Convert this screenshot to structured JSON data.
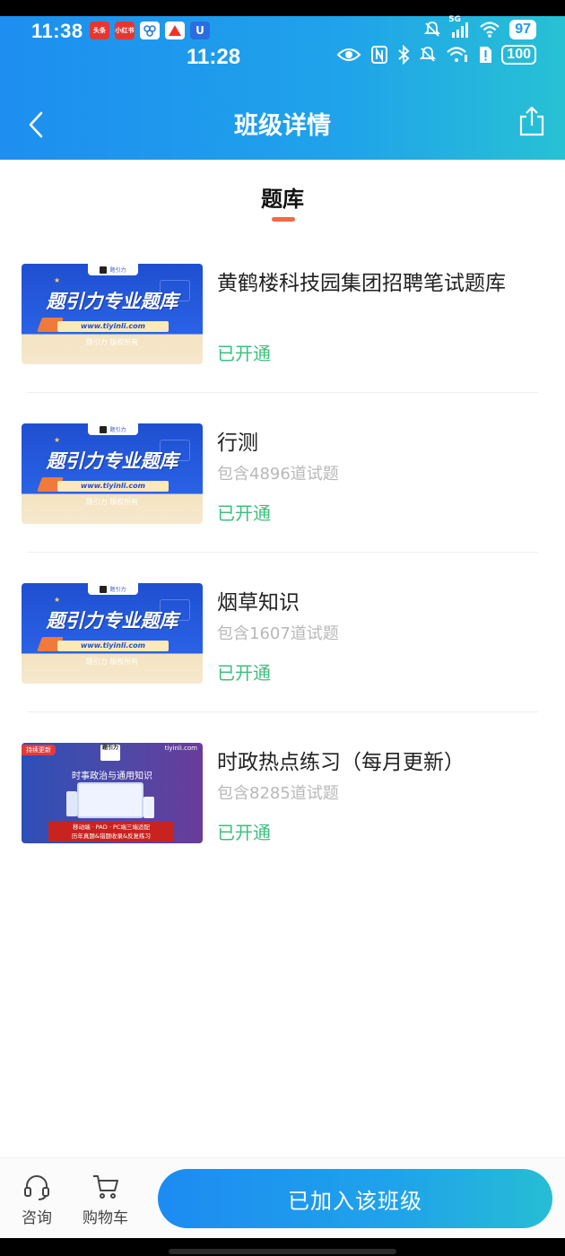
{
  "status_bar": {
    "time_left": "11:38",
    "time_center": "11:28",
    "apps": [
      {
        "label": "头条",
        "color": "#e8362f"
      },
      {
        "label": "小红书",
        "color": "#e8362f"
      },
      {
        "label": "",
        "color": "#2a7de1"
      },
      {
        "label": "",
        "color": "#e8362f"
      },
      {
        "label": "U",
        "color": "#2a6de1"
      }
    ],
    "network": "5G",
    "battery_top": "97",
    "battery_bottom": "100"
  },
  "nav": {
    "title": "班级详情"
  },
  "tabs": [
    {
      "label": "题库",
      "active": true
    }
  ],
  "thumb_text": {
    "brand": "题引力专业题库",
    "logo_label": "题引力",
    "url": "www.tiyinli.com",
    "copyright": "题引力 版权所有",
    "b_badge": "持续更新",
    "b_site": "tiyinli.com",
    "b_mark": "题引力",
    "b_head": "时事政治与通用知识",
    "b_red_line1": "移动端 · PAD · PC端三端适配",
    "b_red_line2": "历年真题&错题收录&反复练习"
  },
  "items": [
    {
      "title": "黄鹤楼科技园集团招聘笔试题库",
      "count": "",
      "status": "已开通",
      "thumb": "A"
    },
    {
      "title": "行测",
      "count": "包含4896道试题",
      "status": "已开通",
      "thumb": "A"
    },
    {
      "title": "烟草知识",
      "count": "包含1607道试题",
      "status": "已开通",
      "thumb": "A"
    },
    {
      "title": "时政热点练习（每月更新）",
      "count": "包含8285道试题",
      "status": "已开通",
      "thumb": "B"
    }
  ],
  "bottom": {
    "consult_label": "咨询",
    "cart_label": "购物车",
    "join_label": "已加入该班级"
  },
  "colors": {
    "header_start": "#1e8ef0",
    "header_end": "#27c1d4",
    "status_green": "#3cbf7c",
    "tab_underline": "#ef6a45"
  },
  "icons": [
    "back-arrow-icon",
    "share-icon",
    "headset-icon",
    "cart-icon",
    "mute-icon",
    "signal-icon",
    "wifi-icon",
    "eye-icon",
    "nfc-icon",
    "bluetooth-icon"
  ]
}
